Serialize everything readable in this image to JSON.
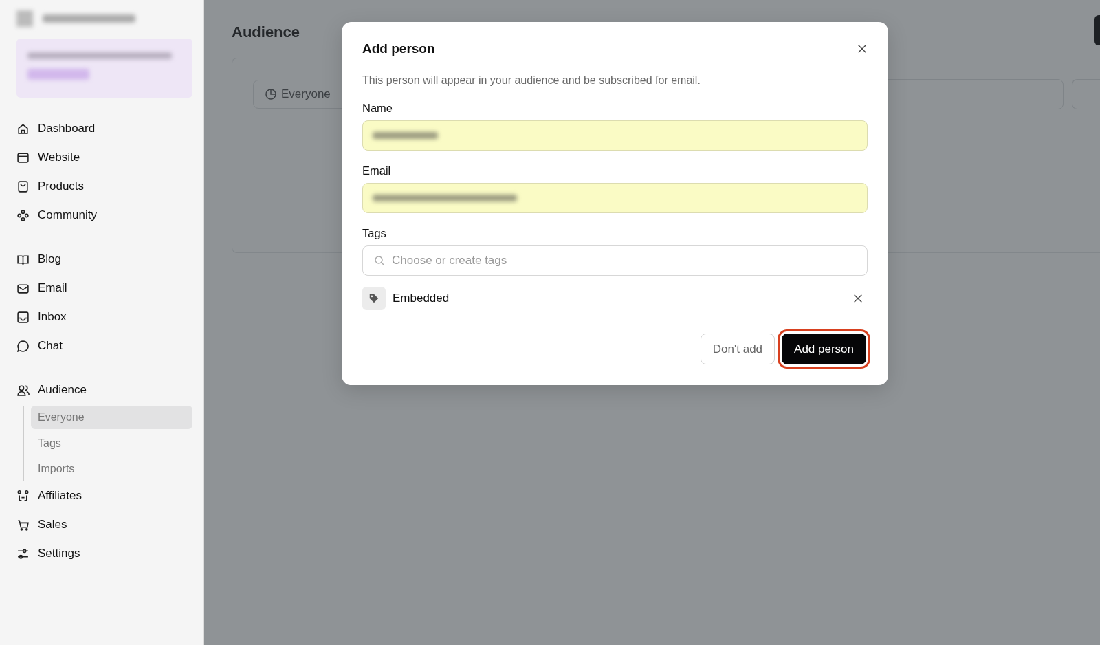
{
  "sidebar": {
    "workspace": {
      "redacted": true
    },
    "promo": {
      "redacted": true
    },
    "sections": [
      {
        "items": [
          {
            "label": "Dashboard",
            "selected": false
          },
          {
            "label": "Website",
            "selected": false
          },
          {
            "label": "Products",
            "selected": false
          },
          {
            "label": "Community",
            "selected": false
          }
        ]
      },
      {
        "items": [
          {
            "label": "Blog",
            "selected": false
          },
          {
            "label": "Email",
            "selected": false
          },
          {
            "label": "Inbox",
            "selected": false
          },
          {
            "label": "Chat",
            "selected": false
          }
        ]
      },
      {
        "items": [
          {
            "label": "Audience",
            "selected": false,
            "children": [
              {
                "label": "Everyone",
                "selected": true
              },
              {
                "label": "Tags",
                "selected": false
              },
              {
                "label": "Imports",
                "selected": false
              }
            ]
          },
          {
            "label": "Affiliates",
            "selected": false
          },
          {
            "label": "Sales",
            "selected": false
          },
          {
            "label": "Settings",
            "selected": false
          }
        ]
      }
    ]
  },
  "page": {
    "title": "Audience",
    "filter": {
      "label": "Everyone"
    }
  },
  "dialog": {
    "title": "Add person",
    "description": "This person will appear in your audience and be subscribed for email.",
    "fields": [
      {
        "label": "Name",
        "redacted": true,
        "autofilled": true
      },
      {
        "label": "Email",
        "redacted": true,
        "autofilled": true
      }
    ],
    "tags": {
      "label": "Tags",
      "placeholder": "Choose or create tags",
      "items": [
        {
          "label": "Embedded"
        }
      ]
    },
    "buttons": [
      {
        "label": "Don't add",
        "kind": "secondary",
        "highlighted": false
      },
      {
        "label": "Add person",
        "kind": "primary",
        "highlighted": true
      }
    ]
  }
}
